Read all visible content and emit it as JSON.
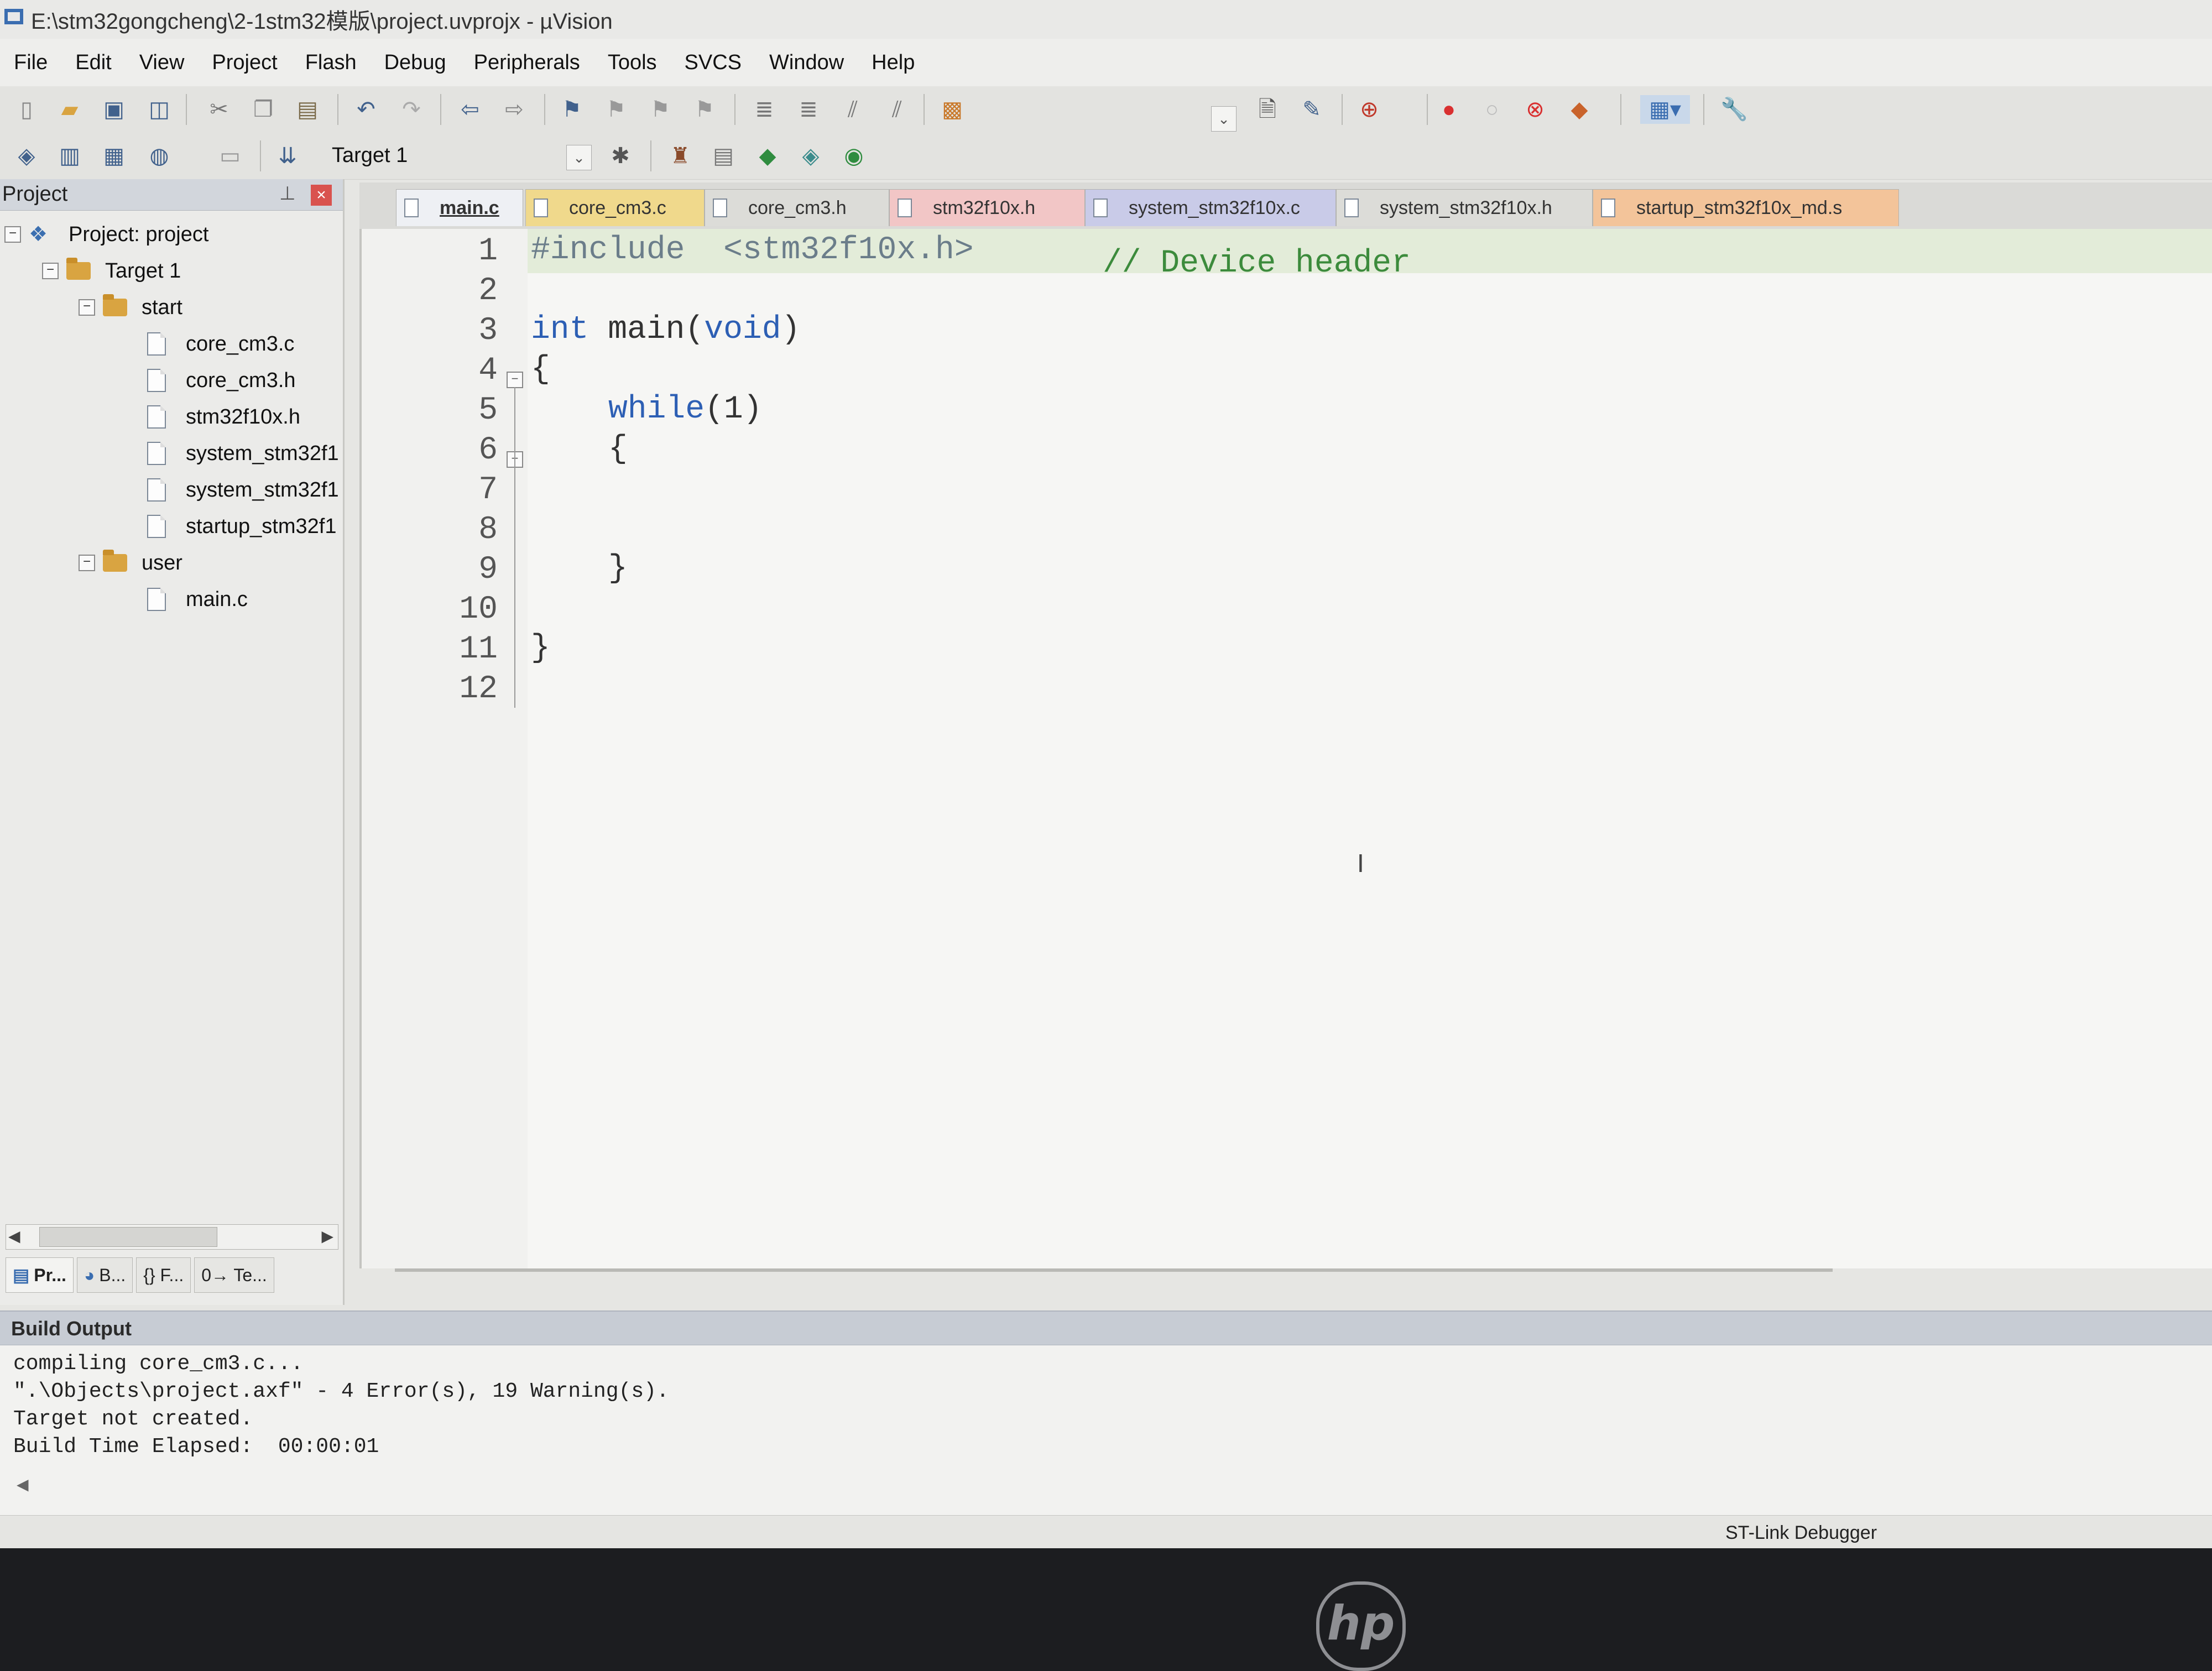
{
  "window": {
    "title": "E:\\stm32gongcheng\\2-1stm32模版\\project.uvprojx - µVision"
  },
  "menu": [
    "File",
    "Edit",
    "View",
    "Project",
    "Flash",
    "Debug",
    "Peripherals",
    "Tools",
    "SVCS",
    "Window",
    "Help"
  ],
  "toolbar2": {
    "target_label": "Target 1"
  },
  "project_panel": {
    "title": "Project",
    "tree": {
      "project": "Project: project",
      "target": "Target 1",
      "groups": [
        {
          "name": "start",
          "files": [
            "core_cm3.c",
            "core_cm3.h",
            "stm32f10x.h",
            "system_stm32f1",
            "system_stm32f1",
            "startup_stm32f1"
          ]
        },
        {
          "name": "user",
          "files": [
            "main.c"
          ]
        }
      ]
    },
    "bottom_tabs": [
      "Pr...",
      "B...",
      "{} F...",
      "0→ Te..."
    ]
  },
  "editor": {
    "tabs": [
      {
        "label": "main.c",
        "active": true,
        "color": "#eef0f4"
      },
      {
        "label": "core_cm3.c",
        "color": "#f0d98c"
      },
      {
        "label": "core_cm3.h",
        "color": "#dcdcd8"
      },
      {
        "label": "stm32f10x.h",
        "color": "#f2c6c6"
      },
      {
        "label": "system_stm32f10x.c",
        "color": "#c9cbe8"
      },
      {
        "label": "system_stm32f10x.h",
        "color": "#dcdcd8"
      },
      {
        "label": "startup_stm32f10x_md.s",
        "color": "#f3c49a"
      }
    ],
    "line_numbers": [
      "1",
      "2",
      "3",
      "4",
      "5",
      "6",
      "7",
      "8",
      "9",
      "10",
      "11",
      "12"
    ],
    "code": {
      "l1_directive": "#include",
      "l1_header": "<stm32f10x.h>",
      "l1_comment": "// Device header",
      "l3_type": "int",
      "l3_name": "main",
      "l3_open": "(",
      "l3_param": "void",
      "l3_close": ")",
      "l4": "{",
      "l5_kw": "while",
      "l5_rest": "(1)",
      "l6": "{",
      "l9": "}",
      "l11": "}"
    }
  },
  "build_output": {
    "title": "Build Output",
    "lines": [
      "compiling core_cm3.c...",
      "\".\\Objects\\project.axf\" - 4 Error(s), 19 Warning(s).",
      "Target not created.",
      "Build Time Elapsed:  00:00:01"
    ]
  },
  "status": {
    "debugger": "ST-Link Debugger"
  },
  "colors": {
    "keyword": "#2d5fb4",
    "comment": "#3c8b3c",
    "highlight_line": "#e3ecd9",
    "close_button": "#d9534f"
  },
  "icons": [
    "new-file-icon",
    "open-folder-icon",
    "save-icon",
    "save-all-icon",
    "cut-icon",
    "copy-icon",
    "paste-icon",
    "undo-icon",
    "redo-icon",
    "nav-back-icon",
    "nav-forward-icon",
    "bookmark-icon",
    "indent-icon",
    "unindent-icon",
    "comment-icon",
    "uncomment-icon",
    "find-in-files-icon",
    "translate-icon",
    "build-icon",
    "rebuild-icon",
    "batch-build-icon",
    "stop-build-icon",
    "download-icon",
    "options-icon",
    "debug-icon",
    "breakpoint-icon",
    "settings-wrench-icon",
    "hp-logo-icon"
  ]
}
